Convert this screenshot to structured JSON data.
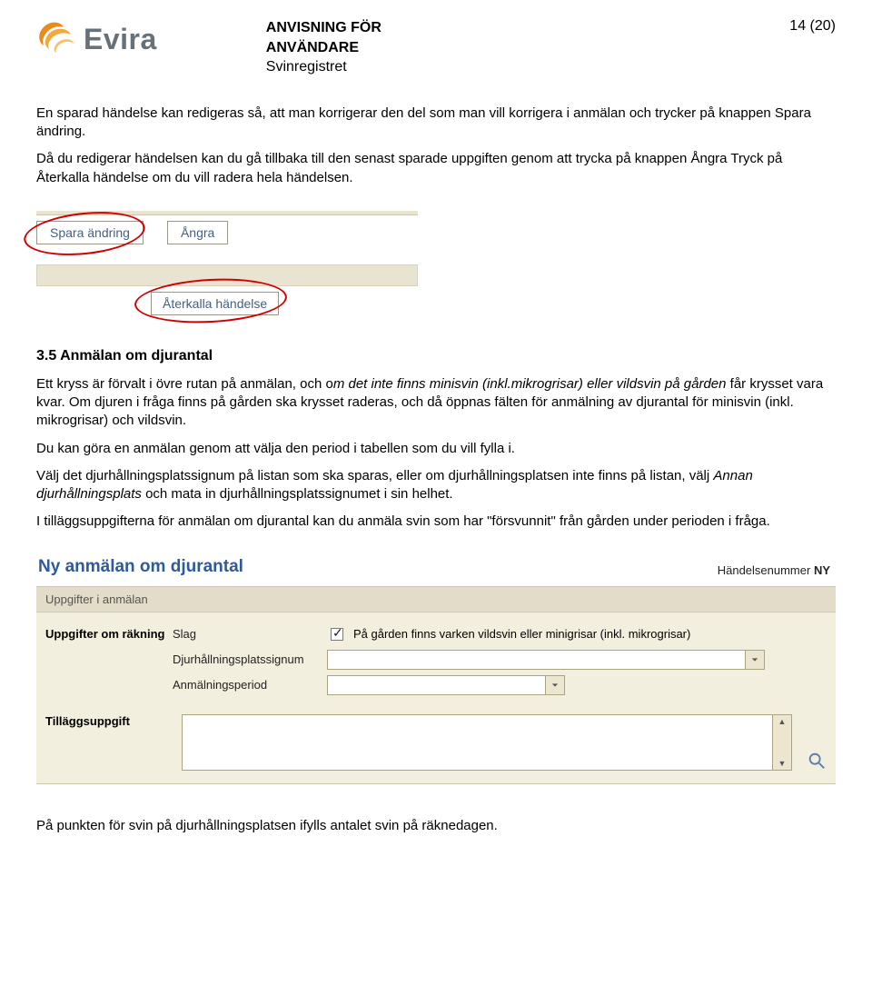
{
  "header": {
    "logo_text": "Evira",
    "doc_line1": "ANVISNING FÖR",
    "doc_line2": "ANVÄNDARE",
    "doc_line3": "Svinregistret",
    "page_indicator": "14 (20)"
  },
  "body": {
    "para1": "En sparad händelse kan redigeras så, att man korrigerar den del som man vill korrigera i anmälan och trycker på knappen Spara ändring.",
    "para2": "Då du redigerar händelsen kan du gå tillbaka till den senast sparade uppgiften genom att trycka på knappen Ångra Tryck på Återkalla händelse om du vill radera hela händelsen.",
    "btn_save": "Spara ändring",
    "btn_undo": "Ångra",
    "btn_recall": "Återkalla händelse",
    "section_heading": "3.5   Anmälan om djurantal",
    "para3a": "Ett kryss är förvalt i övre rutan på anmälan, och o",
    "para3b": "m det inte finns minisvin (inkl.mikrogrisar) eller vildsvin på gården",
    "para3c": " får krysset vara kvar. Om djuren i fråga finns på gården ska krysset raderas, och då öppnas fälten för anmälning av djurantal för minisvin (inkl. mikrogrisar) och vildsvin.",
    "para4": "Du kan göra en anmälan genom att välja den period i tabellen som du vill fylla i.",
    "para5a": "Välj det djurhållningsplatssignum på listan som ska sparas, eller om djurhållningsplatsen inte finns på listan, välj ",
    "para5b": "Annan djurhållningsplats",
    "para5c": " och mata in djurhållningsplatssignumet i sin helhet.",
    "para6": "I tilläggsuppgifterna för anmälan om djurantal kan du anmäla svin som har \"försvunnit\" från gården under perioden i fråga.",
    "final": "På punkten för svin på djurhållningsplatsen ifylls antalet svin på räknedagen."
  },
  "form": {
    "title": "Ny anmälan om djurantal",
    "event_label": "Händelsenummer ",
    "event_value": "NY",
    "section_bar": "Uppgifter i anmälan",
    "group_label": "Uppgifter om räkning",
    "row1_label": "Slag",
    "row1_chk_label": "På gården finns varken vildsvin eller minigrisar (inkl. mikrogrisar)",
    "row2_label": "Djurhållningsplatssignum",
    "row3_label": "Anmälningsperiod",
    "addl_label": "Tilläggsuppgift"
  }
}
